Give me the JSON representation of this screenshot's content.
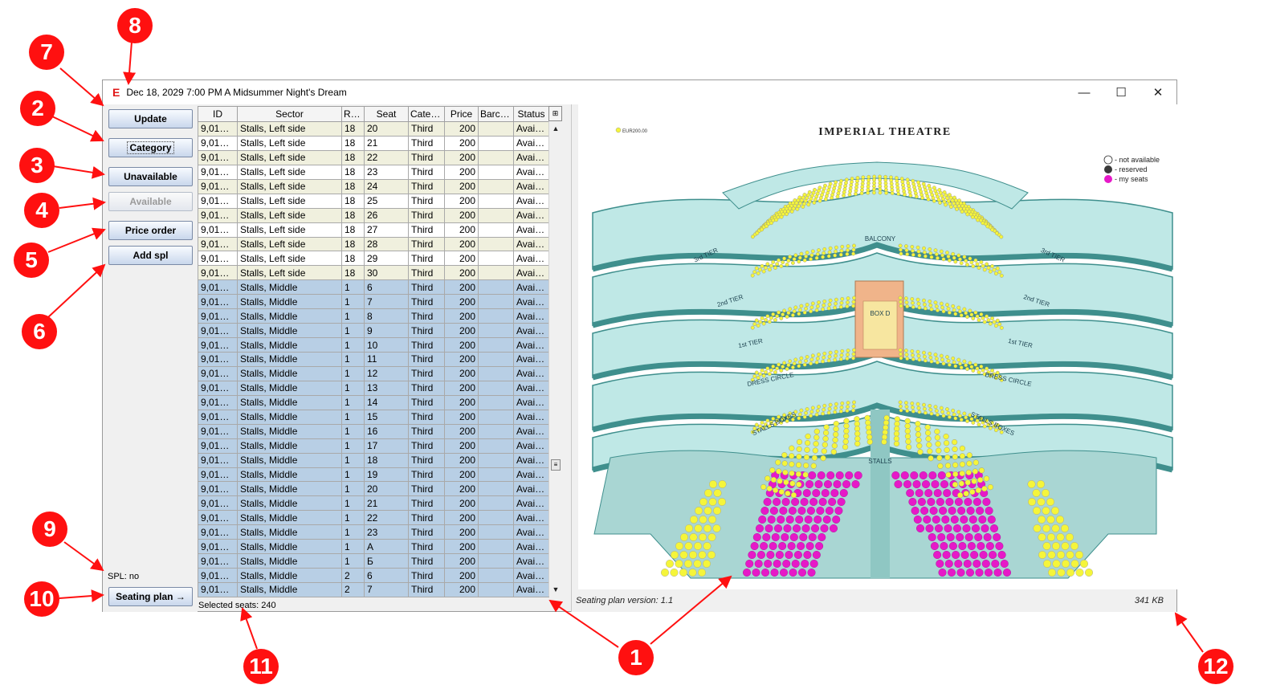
{
  "window": {
    "logo": "E",
    "title": "Dec 18, 2029 7:00 PM A Midsummer Night's Dream",
    "minimize": "—",
    "maximize": "☐",
    "close": "✕"
  },
  "buttons": {
    "update": "Update",
    "category": "Category",
    "unavailable": "Unavailable",
    "available": "Available",
    "price_order": "Price order",
    "add_spl": "Add spl",
    "seating_plan": "Seating plan →"
  },
  "spl_status": "SPL: no",
  "table": {
    "columns": [
      "ID",
      "Sector",
      "Row",
      "Seat",
      "Categ...",
      "Price",
      "Barco...",
      "Status"
    ],
    "rows": [
      {
        "id": "9,018,...",
        "sector": "Stalls, Left side",
        "row": "18",
        "seat": "20",
        "category": "Third",
        "price": "200",
        "barcode": "",
        "status": "Availa...",
        "selected": false
      },
      {
        "id": "9,018,...",
        "sector": "Stalls, Left side",
        "row": "18",
        "seat": "21",
        "category": "Third",
        "price": "200",
        "barcode": "",
        "status": "Availa...",
        "selected": false
      },
      {
        "id": "9,018,...",
        "sector": "Stalls, Left side",
        "row": "18",
        "seat": "22",
        "category": "Third",
        "price": "200",
        "barcode": "",
        "status": "Availa...",
        "selected": false
      },
      {
        "id": "9,018,...",
        "sector": "Stalls, Left side",
        "row": "18",
        "seat": "23",
        "category": "Third",
        "price": "200",
        "barcode": "",
        "status": "Availa...",
        "selected": false
      },
      {
        "id": "9,018,...",
        "sector": "Stalls, Left side",
        "row": "18",
        "seat": "24",
        "category": "Third",
        "price": "200",
        "barcode": "",
        "status": "Availa...",
        "selected": false
      },
      {
        "id": "9,018,...",
        "sector": "Stalls, Left side",
        "row": "18",
        "seat": "25",
        "category": "Third",
        "price": "200",
        "barcode": "",
        "status": "Availa...",
        "selected": false
      },
      {
        "id": "9,018,...",
        "sector": "Stalls, Left side",
        "row": "18",
        "seat": "26",
        "category": "Third",
        "price": "200",
        "barcode": "",
        "status": "Availa...",
        "selected": false
      },
      {
        "id": "9,018,...",
        "sector": "Stalls, Left side",
        "row": "18",
        "seat": "27",
        "category": "Third",
        "price": "200",
        "barcode": "",
        "status": "Availa...",
        "selected": false
      },
      {
        "id": "9,018,...",
        "sector": "Stalls, Left side",
        "row": "18",
        "seat": "28",
        "category": "Third",
        "price": "200",
        "barcode": "",
        "status": "Availa...",
        "selected": false
      },
      {
        "id": "9,018,...",
        "sector": "Stalls, Left side",
        "row": "18",
        "seat": "29",
        "category": "Third",
        "price": "200",
        "barcode": "",
        "status": "Availa...",
        "selected": false
      },
      {
        "id": "9,018,...",
        "sector": "Stalls, Left side",
        "row": "18",
        "seat": "30",
        "category": "Third",
        "price": "200",
        "barcode": "",
        "status": "Availa...",
        "selected": false
      },
      {
        "id": "9,018,...",
        "sector": "Stalls, Middle",
        "row": "1",
        "seat": "6",
        "category": "Third",
        "price": "200",
        "barcode": "",
        "status": "Availa...",
        "selected": true
      },
      {
        "id": "9,018,...",
        "sector": "Stalls, Middle",
        "row": "1",
        "seat": "7",
        "category": "Third",
        "price": "200",
        "barcode": "",
        "status": "Availa...",
        "selected": true
      },
      {
        "id": "9,018,...",
        "sector": "Stalls, Middle",
        "row": "1",
        "seat": "8",
        "category": "Third",
        "price": "200",
        "barcode": "",
        "status": "Availa...",
        "selected": true
      },
      {
        "id": "9,018,...",
        "sector": "Stalls, Middle",
        "row": "1",
        "seat": "9",
        "category": "Third",
        "price": "200",
        "barcode": "",
        "status": "Availa...",
        "selected": true
      },
      {
        "id": "9,018,...",
        "sector": "Stalls, Middle",
        "row": "1",
        "seat": "10",
        "category": "Third",
        "price": "200",
        "barcode": "",
        "status": "Availa...",
        "selected": true
      },
      {
        "id": "9,018,...",
        "sector": "Stalls, Middle",
        "row": "1",
        "seat": "11",
        "category": "Third",
        "price": "200",
        "barcode": "",
        "status": "Availa...",
        "selected": true
      },
      {
        "id": "9,018,...",
        "sector": "Stalls, Middle",
        "row": "1",
        "seat": "12",
        "category": "Third",
        "price": "200",
        "barcode": "",
        "status": "Availa...",
        "selected": true
      },
      {
        "id": "9,018,...",
        "sector": "Stalls, Middle",
        "row": "1",
        "seat": "13",
        "category": "Third",
        "price": "200",
        "barcode": "",
        "status": "Availa...",
        "selected": true
      },
      {
        "id": "9,018,...",
        "sector": "Stalls, Middle",
        "row": "1",
        "seat": "14",
        "category": "Third",
        "price": "200",
        "barcode": "",
        "status": "Availa...",
        "selected": true
      },
      {
        "id": "9,018,...",
        "sector": "Stalls, Middle",
        "row": "1",
        "seat": "15",
        "category": "Third",
        "price": "200",
        "barcode": "",
        "status": "Availa...",
        "selected": true
      },
      {
        "id": "9,018,...",
        "sector": "Stalls, Middle",
        "row": "1",
        "seat": "16",
        "category": "Third",
        "price": "200",
        "barcode": "",
        "status": "Availa...",
        "selected": true
      },
      {
        "id": "9,018,...",
        "sector": "Stalls, Middle",
        "row": "1",
        "seat": "17",
        "category": "Third",
        "price": "200",
        "barcode": "",
        "status": "Availa...",
        "selected": true
      },
      {
        "id": "9,018,...",
        "sector": "Stalls, Middle",
        "row": "1",
        "seat": "18",
        "category": "Third",
        "price": "200",
        "barcode": "",
        "status": "Availa...",
        "selected": true
      },
      {
        "id": "9,018,...",
        "sector": "Stalls, Middle",
        "row": "1",
        "seat": "19",
        "category": "Third",
        "price": "200",
        "barcode": "",
        "status": "Availa...",
        "selected": true
      },
      {
        "id": "9,018,...",
        "sector": "Stalls, Middle",
        "row": "1",
        "seat": "20",
        "category": "Third",
        "price": "200",
        "barcode": "",
        "status": "Availa...",
        "selected": true
      },
      {
        "id": "9,018,...",
        "sector": "Stalls, Middle",
        "row": "1",
        "seat": "21",
        "category": "Third",
        "price": "200",
        "barcode": "",
        "status": "Availa...",
        "selected": true
      },
      {
        "id": "9,018,...",
        "sector": "Stalls, Middle",
        "row": "1",
        "seat": "22",
        "category": "Third",
        "price": "200",
        "barcode": "",
        "status": "Availa...",
        "selected": true
      },
      {
        "id": "9,018,...",
        "sector": "Stalls, Middle",
        "row": "1",
        "seat": "23",
        "category": "Third",
        "price": "200",
        "barcode": "",
        "status": "Availa...",
        "selected": true
      },
      {
        "id": "9,018,...",
        "sector": "Stalls, Middle",
        "row": "1",
        "seat": "A",
        "category": "Third",
        "price": "200",
        "barcode": "",
        "status": "Availa...",
        "selected": true
      },
      {
        "id": "9,018,...",
        "sector": "Stalls, Middle",
        "row": "1",
        "seat": "Б",
        "category": "Third",
        "price": "200",
        "barcode": "",
        "status": "Availa...",
        "selected": true
      },
      {
        "id": "9,018,...",
        "sector": "Stalls, Middle",
        "row": "2",
        "seat": "6",
        "category": "Third",
        "price": "200",
        "barcode": "",
        "status": "Availa...",
        "selected": true
      },
      {
        "id": "9,018,...",
        "sector": "Stalls, Middle",
        "row": "2",
        "seat": "7",
        "category": "Third",
        "price": "200",
        "barcode": "",
        "status": "Availa...",
        "selected": true
      }
    ]
  },
  "selected_seats": "Selected seats: 240",
  "plan": {
    "theatre_name": "IMPERIAL THEATRE",
    "price_legend": "EUR200.00",
    "legend": [
      "- not available",
      "- reserved",
      "- my seats"
    ],
    "sections": [
      "3rd TIER",
      "2nd TIER",
      "1st TIER",
      "DRESS CIRCLE",
      "STALLS BOXES",
      "STALLS",
      "BALCONY",
      "BOX D"
    ],
    "version": "Seating plan version: 1.1",
    "size": "341 KB",
    "colors": {
      "available": "#f5f53a",
      "my_seats": "#e619c8",
      "reserved": "#3a3a3a",
      "structure": "#bfe8e6",
      "structure_dark": "#3f8f8d"
    }
  },
  "callouts": [
    "1",
    "2",
    "3",
    "4",
    "5",
    "6",
    "7",
    "8",
    "9",
    "10",
    "11",
    "12",
    "1"
  ]
}
